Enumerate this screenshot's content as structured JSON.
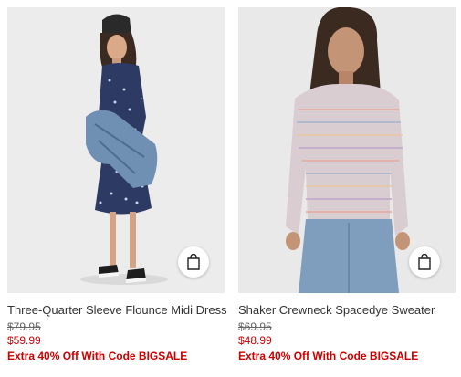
{
  "products": [
    {
      "name": "Three-Quarter Sleeve Flounce Midi Dress",
      "original_price": "$79.95",
      "sale_price": "$59.99",
      "promo": "Extra 40% Off With Code BIGSALE",
      "image_desc": "model-in-floral-midi-dress",
      "image_bg": "#ececec"
    },
    {
      "name": "Shaker Crewneck Spacedye Sweater",
      "original_price": "$69.95",
      "sale_price": "$48.99",
      "promo": "Extra 40% Off With Code BIGSALE",
      "image_desc": "model-in-spacedye-sweater",
      "image_bg": "#e9e9e9"
    }
  ],
  "icons": {
    "quick_add": "shopping-bag-icon"
  },
  "colors": {
    "sale": "#cc0000",
    "text": "#333333",
    "original_price": "#666666"
  }
}
